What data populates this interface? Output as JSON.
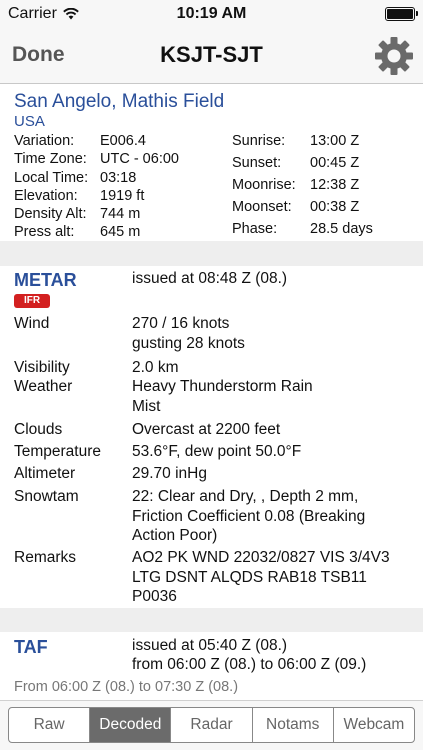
{
  "status_bar": {
    "carrier": "Carrier",
    "time": "10:19 AM"
  },
  "nav": {
    "done_label": "Done",
    "title": "KSJT-SJT"
  },
  "airport": {
    "name": "San Angelo, Mathis Field",
    "country": "USA",
    "left_info": [
      {
        "label": "Variation:",
        "value": "E006.4"
      },
      {
        "label": "Time Zone:",
        "value": "UTC - 06:00"
      },
      {
        "label": "Local Time:",
        "value": "03:18"
      },
      {
        "label": "Elevation:",
        "value": "1919 ft"
      },
      {
        "label": "Density Alt:",
        "value": "744 m"
      },
      {
        "label": "Press alt:",
        "value": "645 m"
      }
    ],
    "right_info": [
      {
        "label": "Sunrise:",
        "value": "13:00 Z"
      },
      {
        "label": "Sunset:",
        "value": "00:45 Z"
      },
      {
        "label": "Moonrise:",
        "value": "12:38 Z"
      },
      {
        "label": "Moonset:",
        "value": "00:38 Z"
      },
      {
        "label": "Phase:",
        "value": "28.5 days"
      }
    ]
  },
  "metar": {
    "heading": "METAR",
    "issued": "issued at 08:48 Z (08.)",
    "flight_category": "IFR",
    "rows": [
      {
        "label": "Wind",
        "value": "270 / 16 knots\ngusting 28 knots"
      },
      {
        "label": "Visibility",
        "value": "2.0 km"
      },
      {
        "label": "Weather",
        "value": "Heavy Thunderstorm Rain\nMist"
      },
      {
        "label": "Clouds",
        "value": "Overcast at 2200 feet"
      },
      {
        "label": "Temperature",
        "value": "53.6°F, dew point 50.0°F"
      },
      {
        "label": "Altimeter",
        "value": "29.70 inHg"
      },
      {
        "label": "Snowtam",
        "value": "22: Clear and Dry, , Depth 2 mm,\nFriction Coefficient 0.08 (Breaking\nAction Poor)"
      },
      {
        "label": "Remarks",
        "value": "AO2 PK WND 22032/0827 VIS 3/4V3\nLTG DSNT ALQDS RAB18 TSB11\nP0036"
      }
    ]
  },
  "taf": {
    "heading": "TAF",
    "issued": "issued at 05:40 Z (08.)",
    "validity": "from 06:00 Z (08.) to 06:00 Z (09.)",
    "period": "From 06:00 Z (08.) to 07:30 Z (08.)"
  },
  "tabs": [
    {
      "label": "Raw",
      "active": false
    },
    {
      "label": "Decoded",
      "active": true
    },
    {
      "label": "Radar",
      "active": false
    },
    {
      "label": "Notams",
      "active": false
    },
    {
      "label": "Webcam",
      "active": false
    }
  ],
  "colors": {
    "accent": "#2a4f9a",
    "ifr_badge": "#d32020",
    "active_tab": "#6b6b6b"
  }
}
